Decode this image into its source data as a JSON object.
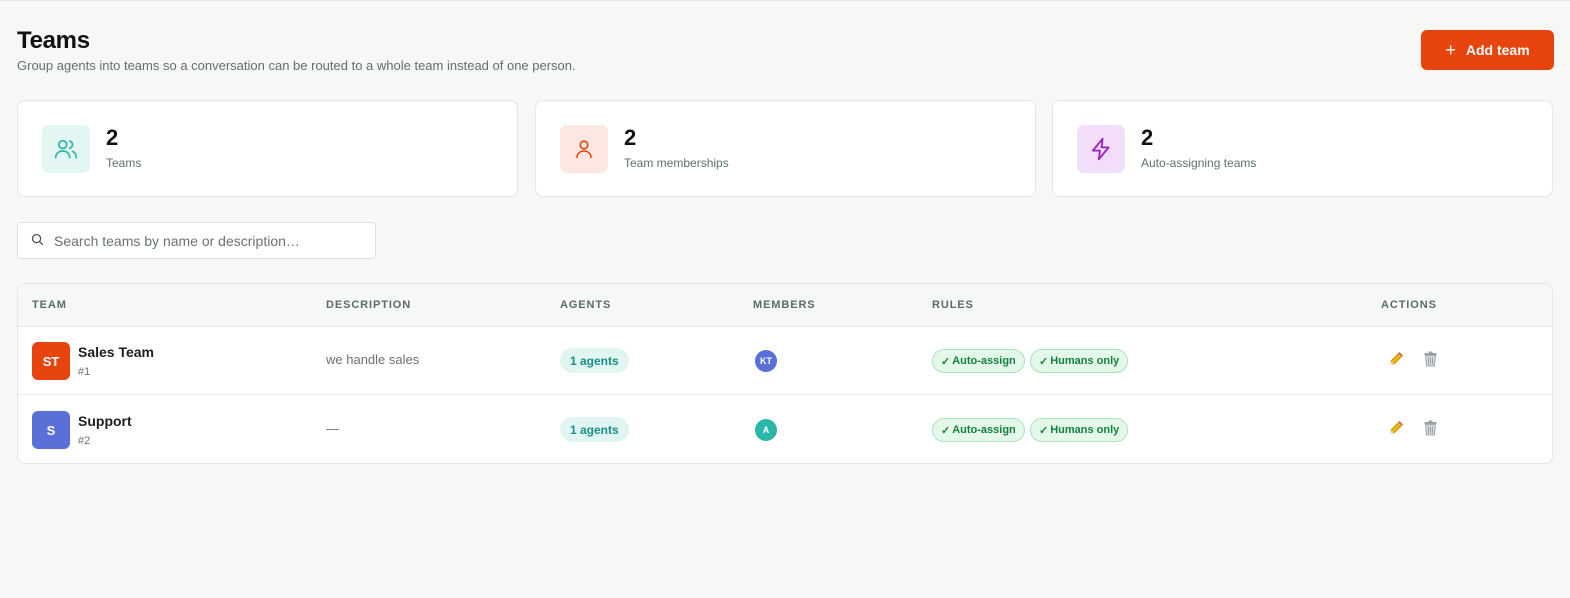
{
  "header": {
    "title": "Teams",
    "subtitle": "Group agents into teams so a conversation can be routed to a whole team instead of one person.",
    "add_button_label": "Add team"
  },
  "stats": [
    {
      "value": "2",
      "label": "Teams",
      "icon": "users-icon",
      "color": "#2bb7a7"
    },
    {
      "value": "2",
      "label": "Team memberships",
      "icon": "user-icon",
      "color": "#e8440e"
    },
    {
      "value": "2",
      "label": "Auto-assigning teams",
      "icon": "bolt-icon",
      "color": "#a020c8"
    }
  ],
  "search": {
    "placeholder": "Search teams by name or description…",
    "value": ""
  },
  "table": {
    "columns": [
      "TEAM",
      "DESCRIPTION",
      "AGENTS",
      "MEMBERS",
      "RULES",
      "ACTIONS"
    ],
    "rows": [
      {
        "initials": "ST",
        "avatar_color": "#e8440e",
        "name": "Sales Team",
        "id": "#1",
        "description": "we handle sales",
        "agents": "1 agents",
        "member_initials": "KT",
        "member_color": "#5b6fd8",
        "rules": [
          "Auto-assign",
          "Humans only"
        ]
      },
      {
        "initials": "S",
        "avatar_color": "#5b6fd8",
        "name": "Support",
        "id": "#2",
        "description": "—",
        "agents": "1 agents",
        "member_initials": "A",
        "member_color": "#2bb7a7",
        "rules": [
          "Auto-assign",
          "Humans only"
        ]
      }
    ]
  },
  "icons": {
    "check": "✓",
    "plus": "+"
  }
}
